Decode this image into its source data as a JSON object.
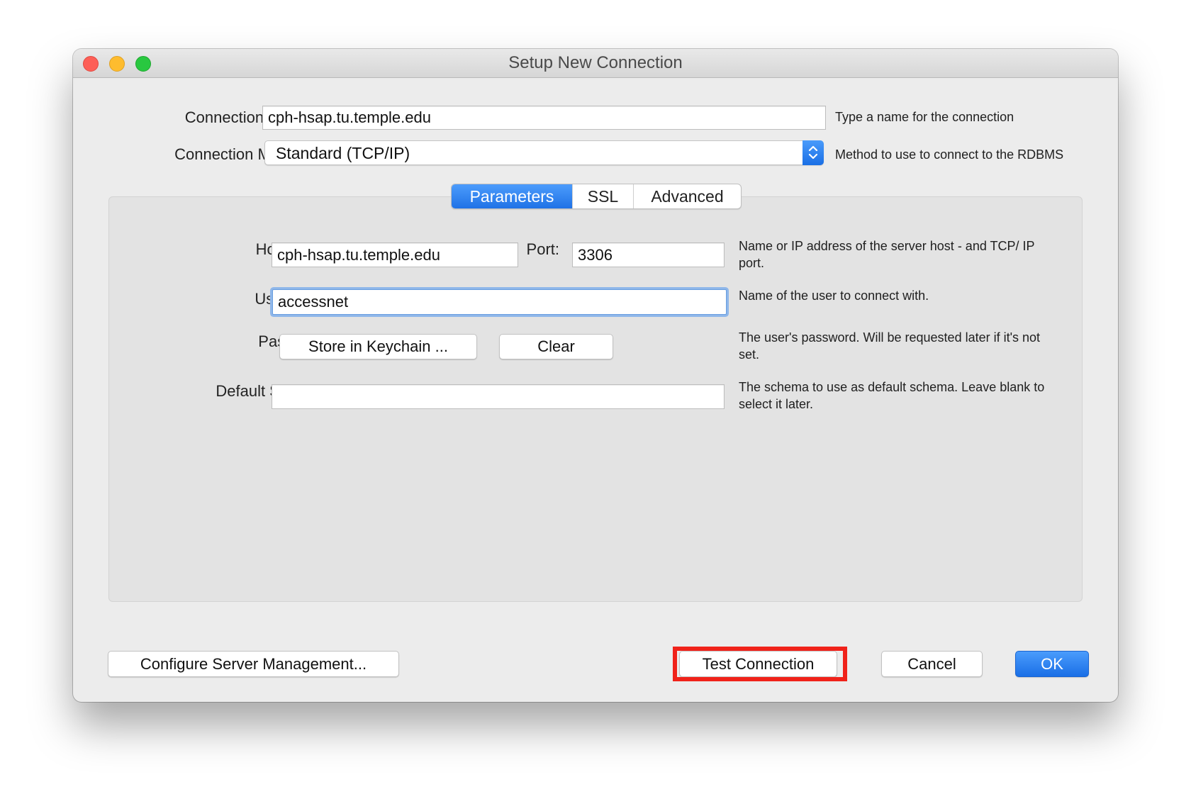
{
  "window": {
    "title": "Setup New Connection"
  },
  "connection_name": {
    "label": "Connection Name:",
    "value": "cph-hsap.tu.temple.edu",
    "hint": "Type a name for the connection"
  },
  "connection_method": {
    "label": "Connection Method:",
    "value": "Standard (TCP/IP)",
    "hint": "Method to use to connect to the RDBMS"
  },
  "tabs": [
    {
      "label": "Parameters",
      "active": true
    },
    {
      "label": "SSL",
      "active": false
    },
    {
      "label": "Advanced",
      "active": false
    }
  ],
  "parameters": {
    "hostname": {
      "label": "Hostname:",
      "value": "cph-hsap.tu.temple.edu"
    },
    "port": {
      "label": "Port:",
      "value": "3306"
    },
    "host_hint": "Name or IP address of the server host - and TCP/ IP port.",
    "username": {
      "label": "Username:",
      "value": "accessnet",
      "hint": "Name of the user to connect with."
    },
    "password": {
      "label": "Password:",
      "store_button": "Store in Keychain ...",
      "clear_button": "Clear",
      "hint": "The user's password. Will be requested later if it's not set."
    },
    "default_schema": {
      "label": "Default Schema:",
      "value": "",
      "hint": "The schema to use as default schema. Leave blank to select it later."
    }
  },
  "footer": {
    "configure_button": "Configure Server Management...",
    "test_button": "Test Connection",
    "cancel_button": "Cancel",
    "ok_button": "OK"
  },
  "colors": {
    "accent": "#1f72e6",
    "highlight": "#f0221a",
    "close": "#fd5f57",
    "minimize": "#febc2e",
    "maximize": "#29c840"
  }
}
